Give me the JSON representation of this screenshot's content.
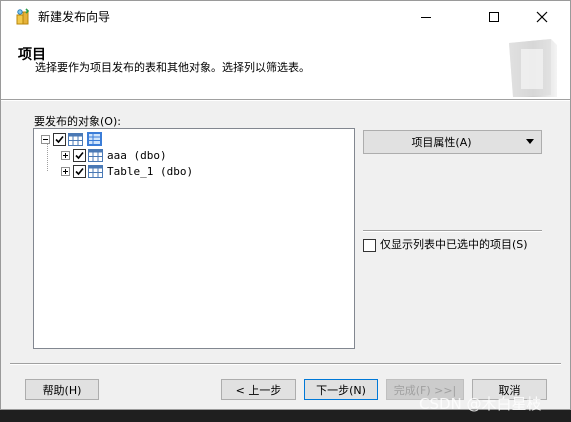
{
  "window": {
    "title": "新建发布向导",
    "controls": {
      "minimize": "minimize",
      "maximize": "maximize",
      "close": "close"
    }
  },
  "header": {
    "title": "项目",
    "description": "选择要作为项目发布的表和其他对象。选择列以筛选表。"
  },
  "objects": {
    "label": "要发布的对象(O):",
    "root_icon": "tables-folder-icon",
    "items": [
      {
        "label": "aaa (dbo)",
        "checked": true
      },
      {
        "label": "Table_1 (dbo)",
        "checked": true
      }
    ]
  },
  "properties_button": {
    "label": "项目属性(A)"
  },
  "show_only_checkbox": {
    "label": "仅显示列表中已选中的项目(S)",
    "checked": false
  },
  "buttons": {
    "help": "帮助(H)",
    "back": "< 上一步",
    "next": "下一步(N)",
    "finish": "完成(F) >>|",
    "cancel": "取消"
  },
  "watermark": "CSDN @木白星枝"
}
